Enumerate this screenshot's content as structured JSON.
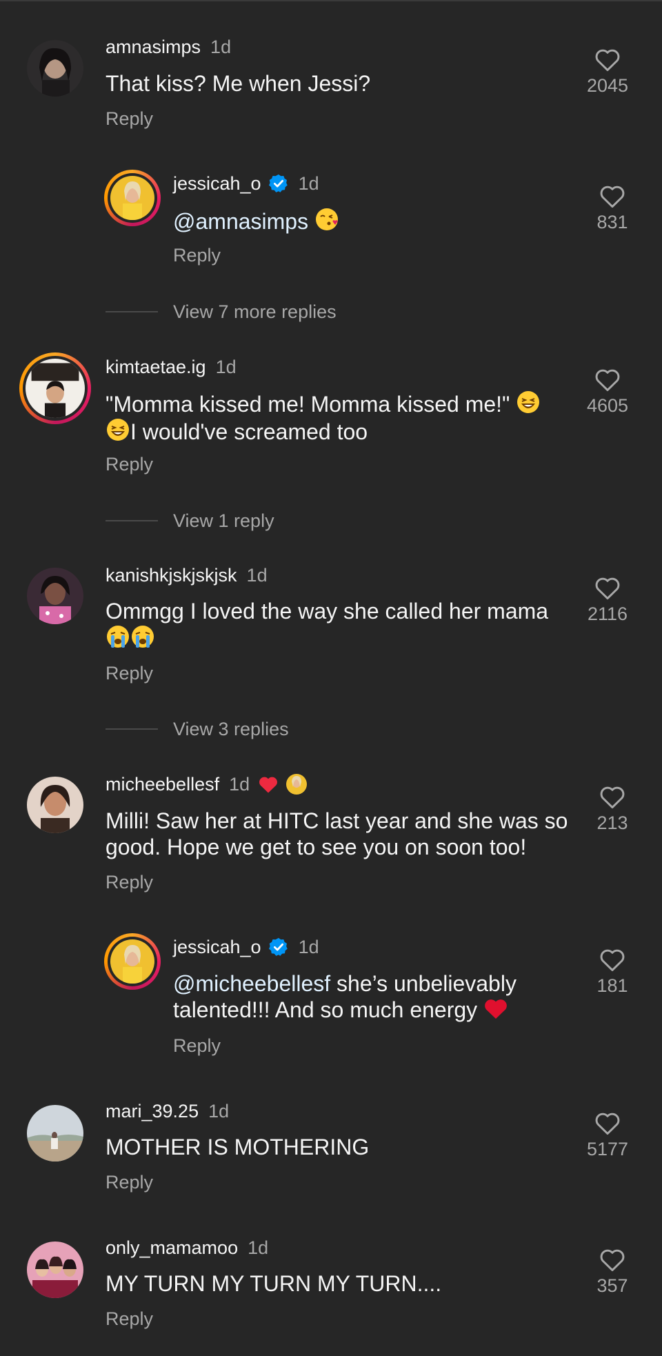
{
  "comments": [
    {
      "username": "amnasimps",
      "time": "1d",
      "text": "That kiss? Me when Jessi?",
      "reply": "Reply",
      "likes": "2045"
    },
    {
      "username": "jessicah_o",
      "time": "1d",
      "mention": "@amnasimps",
      "text": "",
      "reply": "Reply",
      "likes": "831",
      "verified": true
    },
    {
      "username": "kimtaetae.ig",
      "time": "1d",
      "text_line1": "\"Momma kissed me! Momma kissed me!\"",
      "text_line2": "I would've screamed too",
      "reply": "Reply",
      "likes": "4605"
    },
    {
      "username": "kanishkjskjskjsk",
      "time": "1d",
      "text": "Ommgg I loved the way she called her mama",
      "reply": "Reply",
      "likes": "2116"
    },
    {
      "username": "micheebellesf",
      "time": "1d",
      "text_line1": "Milli! Saw her at HITC last year and she was so",
      "text_line2": "good. Hope we get to see you on soon too!",
      "reply": "Reply",
      "likes": "213"
    },
    {
      "username": "jessicah_o",
      "time": "1d",
      "mention": "@micheebellesf",
      "text_line1": " she’s unbelievably",
      "text_line2": "talented!!! And so much energy",
      "reply": "Reply",
      "likes": "181",
      "verified": true
    },
    {
      "username": "mari_39.25",
      "time": "1d",
      "text": "MOTHER IS MOTHERING",
      "reply": "Reply",
      "likes": "5177"
    },
    {
      "username": "only_mamamoo",
      "time": "1d",
      "text": "MY TURN MY TURN MY TURN....",
      "reply": "Reply",
      "likes": "357"
    }
  ],
  "view_more": [
    {
      "label": "View 7 more replies"
    },
    {
      "label": "View 1 reply"
    },
    {
      "label": "View 3 replies"
    }
  ],
  "icons": {
    "heart": "heart-outline-icon",
    "verified": "verified-badge-icon",
    "accent": "#0095f6",
    "heart_emoji_color": "#e0245e"
  }
}
